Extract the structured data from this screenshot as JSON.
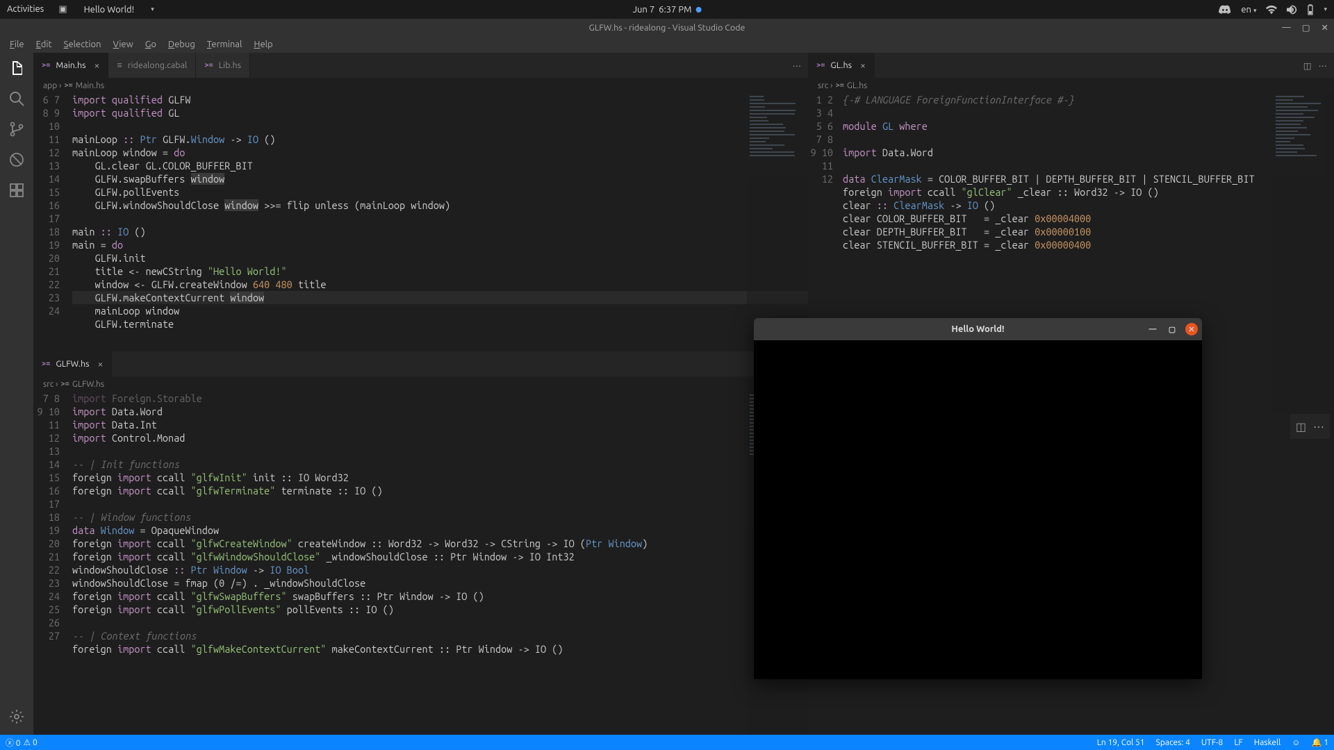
{
  "gnome": {
    "activities": "Activities",
    "app": "Hello World!",
    "date": "Jun 7",
    "time": "6:37 PM",
    "lang": "en"
  },
  "window_title": "GLFW.hs - ridealong - Visual Studio Code",
  "menu": [
    "File",
    "Edit",
    "Selection",
    "View",
    "Go",
    "Debug",
    "Terminal",
    "Help"
  ],
  "group1": {
    "tabs": [
      {
        "label": "Main.hs",
        "active": true,
        "icon": "hs",
        "closable": true
      },
      {
        "label": "ridealong.cabal",
        "active": false,
        "icon": "list",
        "closable": false
      },
      {
        "label": "Lib.hs",
        "active": false,
        "icon": "hs",
        "closable": false
      }
    ],
    "breadcrumbs": [
      "app",
      "Main.hs"
    ],
    "first_line": 6,
    "code": [
      [
        [
          "kw",
          "import"
        ],
        [
          "id",
          " "
        ],
        [
          "kw",
          "qualified"
        ],
        [
          "id",
          " GLFW"
        ]
      ],
      [
        [
          "kw",
          "import"
        ],
        [
          "id",
          " "
        ],
        [
          "kw",
          "qualified"
        ],
        [
          "id",
          " GL"
        ]
      ],
      [],
      [
        [
          "id",
          "mainLoop "
        ],
        [
          "kw",
          "::"
        ],
        [
          "id",
          " "
        ],
        [
          "ty",
          "Ptr"
        ],
        [
          "id",
          " GLFW."
        ],
        [
          "ty",
          "Window"
        ],
        [
          "id",
          " -> "
        ],
        [
          "ty",
          "IO"
        ],
        [
          "id",
          " ()"
        ]
      ],
      [
        [
          "id",
          "mainLoop window = "
        ],
        [
          "kw",
          "do"
        ]
      ],
      [
        [
          "id",
          "    GL.clear GL.COLOR_BUFFER_BIT"
        ]
      ],
      [
        [
          "id",
          "    GLFW.swapBuffers "
        ],
        [
          "hl",
          "window"
        ]
      ],
      [
        [
          "id",
          "    GLFW.pollEvents"
        ]
      ],
      [
        [
          "id",
          "    GLFW.windowShouldClose "
        ],
        [
          "hl",
          "window"
        ],
        [
          "id",
          " >>= flip unless (mainLoop window)"
        ]
      ],
      [],
      [
        [
          "id",
          "main "
        ],
        [
          "kw",
          "::"
        ],
        [
          "id",
          " "
        ],
        [
          "ty",
          "IO"
        ],
        [
          "id",
          " ()"
        ]
      ],
      [
        [
          "id",
          "main = "
        ],
        [
          "kw",
          "do"
        ]
      ],
      [
        [
          "id",
          "    GLFW.init"
        ]
      ],
      [
        [
          "id",
          "    title <- newCString "
        ],
        [
          "st",
          "\"Hello World!\""
        ]
      ],
      [
        [
          "id",
          "    window <- GLFW.createWindow "
        ],
        [
          "nm",
          "640"
        ],
        [
          "id",
          " "
        ],
        [
          "nm",
          "480"
        ],
        [
          "id",
          " title"
        ]
      ],
      [
        [
          "id",
          "    GLFW.makeContextCurrent "
        ],
        [
          "hl",
          "window"
        ]
      ],
      [
        [
          "id",
          "    mainLoop window"
        ]
      ],
      [
        [
          "id",
          "    GLFW.terminate"
        ]
      ],
      []
    ],
    "selected_line_index": 15
  },
  "group2": {
    "tabs": [
      {
        "label": "GL.hs",
        "active": true,
        "icon": "hs",
        "closable": true
      }
    ],
    "breadcrumbs": [
      "src",
      "GL.hs"
    ],
    "first_line": 1,
    "code": [
      [
        [
          "cm",
          "{-# LANGUAGE ForeignFunctionInterface #-}"
        ]
      ],
      [],
      [
        [
          "kw",
          "module"
        ],
        [
          "id",
          " "
        ],
        [
          "ty",
          "GL"
        ],
        [
          "id",
          " "
        ],
        [
          "kw",
          "where"
        ]
      ],
      [],
      [
        [
          "kw",
          "import"
        ],
        [
          "id",
          " Data.Word"
        ]
      ],
      [],
      [
        [
          "kw",
          "data"
        ],
        [
          "id",
          " "
        ],
        [
          "ty",
          "ClearMask"
        ],
        [
          "id",
          " = COLOR_BUFFER_BIT | DEPTH_BUFFER_BIT | STENCIL_BUFFER_BIT"
        ]
      ],
      [
        [
          "id",
          "foreign "
        ],
        [
          "kw",
          "import"
        ],
        [
          "id",
          " ccall "
        ],
        [
          "st",
          "\"glClear\""
        ],
        [
          "id",
          " _clear :: Word32 -> IO ()"
        ]
      ],
      [
        [
          "id",
          "clear "
        ],
        [
          "kw",
          "::"
        ],
        [
          "id",
          " "
        ],
        [
          "ty",
          "ClearMask"
        ],
        [
          "id",
          " -> "
        ],
        [
          "ty",
          "IO"
        ],
        [
          "id",
          " ()"
        ]
      ],
      [
        [
          "id",
          "clear COLOR_BUFFER_BIT   = _clear "
        ],
        [
          "nm",
          "0x00004000"
        ]
      ],
      [
        [
          "id",
          "clear DEPTH_BUFFER_BIT   = _clear "
        ],
        [
          "nm",
          "0x00000100"
        ]
      ],
      [
        [
          "id",
          "clear STENCIL_BUFFER_BIT = _clear "
        ],
        [
          "nm",
          "0x00000400"
        ]
      ]
    ]
  },
  "group3": {
    "tabs": [
      {
        "label": "GLFW.hs",
        "active": true,
        "icon": "hs",
        "closable": true
      }
    ],
    "breadcrumbs": [
      "src",
      "GLFW.hs"
    ],
    "first_line": 7,
    "partial_top": "import Foreign.Storable",
    "code": [
      [
        [
          "kw",
          "import"
        ],
        [
          "id",
          " Data.Word"
        ]
      ],
      [
        [
          "kw",
          "import"
        ],
        [
          "id",
          " Data.Int"
        ]
      ],
      [
        [
          "kw",
          "import"
        ],
        [
          "id",
          " Control.Monad"
        ]
      ],
      [],
      [
        [
          "cm",
          "-- | Init functions"
        ]
      ],
      [
        [
          "id",
          "foreign "
        ],
        [
          "kw",
          "import"
        ],
        [
          "id",
          " ccall "
        ],
        [
          "st",
          "\"glfwInit\""
        ],
        [
          "id",
          " init :: IO Word32"
        ]
      ],
      [
        [
          "id",
          "foreign "
        ],
        [
          "kw",
          "import"
        ],
        [
          "id",
          " ccall "
        ],
        [
          "st",
          "\"glfwTerminate\""
        ],
        [
          "id",
          " terminate :: IO ()"
        ]
      ],
      [],
      [
        [
          "cm",
          "-- | Window functions"
        ]
      ],
      [
        [
          "kw",
          "data"
        ],
        [
          "id",
          " "
        ],
        [
          "ty",
          "Window"
        ],
        [
          "id",
          " = OpaqueWindow"
        ]
      ],
      [
        [
          "id",
          "foreign "
        ],
        [
          "kw",
          "import"
        ],
        [
          "id",
          " ccall "
        ],
        [
          "st",
          "\"glfwCreateWindow\""
        ],
        [
          "id",
          " createWindow :: Word32 -> Word32 -> CString -> IO ("
        ],
        [
          "ty",
          "Ptr Window"
        ],
        [
          "id",
          ")"
        ]
      ],
      [
        [
          "id",
          "foreign "
        ],
        [
          "kw",
          "import"
        ],
        [
          "id",
          " ccall "
        ],
        [
          "st",
          "\"glfwWindowShouldClose\""
        ],
        [
          "id",
          " _windowShouldClose :: Ptr Window -> IO Int32"
        ]
      ],
      [
        [
          "id",
          "windowShouldClose "
        ],
        [
          "kw",
          "::"
        ],
        [
          "id",
          " "
        ],
        [
          "ty",
          "Ptr Window"
        ],
        [
          "id",
          " -> "
        ],
        [
          "ty",
          "IO Bool"
        ]
      ],
      [
        [
          "id",
          "windowShouldClose = fmap (0 /=) . _windowShouldClose"
        ]
      ],
      [
        [
          "id",
          "foreign "
        ],
        [
          "kw",
          "import"
        ],
        [
          "id",
          " ccall "
        ],
        [
          "st",
          "\"glfwSwapBuffers\""
        ],
        [
          "id",
          " swapBuffers :: Ptr Window -> IO ()"
        ]
      ],
      [
        [
          "id",
          "foreign "
        ],
        [
          "kw",
          "import"
        ],
        [
          "id",
          " ccall "
        ],
        [
          "st",
          "\"glfwPollEvents\""
        ],
        [
          "id",
          " pollEvents :: IO ()"
        ]
      ],
      [],
      [
        [
          "cm",
          "-- | Context functions"
        ]
      ],
      [
        [
          "id",
          "foreign "
        ],
        [
          "kw",
          "import"
        ],
        [
          "id",
          " ccall "
        ],
        [
          "st",
          "\"glfwMakeContextCurrent\""
        ],
        [
          "id",
          " makeContextCurrent :: Ptr Window -> IO ()"
        ]
      ],
      []
    ]
  },
  "status": {
    "errors": "0",
    "warnings": "0",
    "cursor": "Ln 19, Col 51",
    "spaces": "Spaces: 4",
    "encoding": "UTF-8",
    "eol": "LF",
    "lang": "Haskell",
    "bell": "1"
  },
  "floating_window": {
    "title": "Hello World!"
  }
}
